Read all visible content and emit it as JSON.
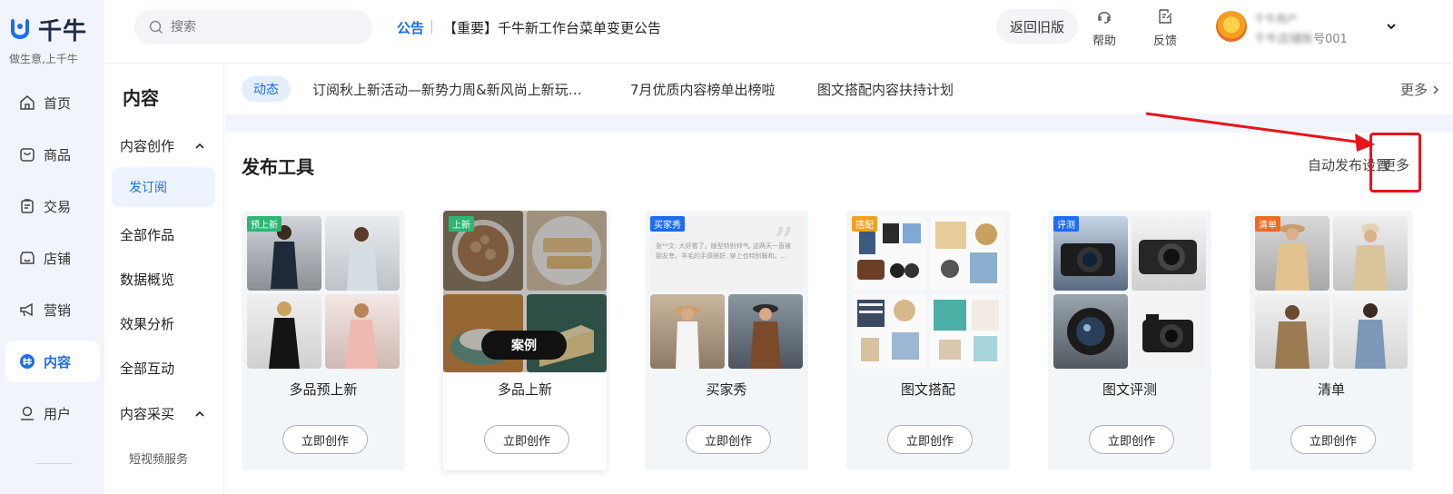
{
  "brand": {
    "name": "千牛",
    "slogan": "做生意,上千牛"
  },
  "rail": [
    {
      "label": "首页",
      "icon": "home-icon"
    },
    {
      "label": "商品",
      "icon": "bag-icon"
    },
    {
      "label": "交易",
      "icon": "clipboard-icon"
    },
    {
      "label": "店铺",
      "icon": "store-icon"
    },
    {
      "label": "营销",
      "icon": "megaphone-icon"
    },
    {
      "label": "内容",
      "icon": "content-icon",
      "active": true
    },
    {
      "label": "用户",
      "icon": "user-icon"
    }
  ],
  "header": {
    "search_placeholder": "搜索",
    "notice_label": "公告",
    "notice_text": "【重要】千牛新工作台菜单变更公告",
    "old_version": "返回旧版",
    "help": "帮助",
    "feedback": "反馈",
    "user": {
      "name": "千牛用户",
      "shop_prefix": "千牛店铺账",
      "shop_suffix": "号001"
    }
  },
  "subnav": {
    "title": "内容",
    "group_create": "内容创作",
    "publish": "发订阅",
    "all_works": "全部作品",
    "data_overview": "数据概览",
    "effect": "效果分析",
    "interaction": "全部互动",
    "group_purchase": "内容采买",
    "short_video": "短视频服务"
  },
  "news": {
    "tag": "动态",
    "items": [
      "订阅秋上新活动—新势力周&新风尚上新玩…",
      "7月优质内容榜单出榜啦",
      "图文搭配内容扶持计划"
    ],
    "more": "更多"
  },
  "tools": {
    "title": "发布工具",
    "auto_setting": "自动发布设置",
    "more": "更多",
    "create_label": "立即创作",
    "case_label": "案例",
    "cards": [
      {
        "name": "多品预上新",
        "tag": "预上新",
        "tag_color": "#2bb673"
      },
      {
        "name": "多品上新",
        "tag": "上新",
        "tag_color": "#2bb673"
      },
      {
        "name": "买家秀",
        "tag": "买家秀",
        "tag_color": "#1d6cf2",
        "quote": "张**文: 大好看了。版型特别帅气, 这两天一直被朋友夸。羊毛的手感很好, 穿上也特别暖和。..."
      },
      {
        "name": "图文搭配",
        "tag": "搭配",
        "tag_color": "#f5a020"
      },
      {
        "name": "图文评测",
        "tag": "评测",
        "tag_color": "#1d6cf2"
      },
      {
        "name": "清单",
        "tag": "清单",
        "tag_color": "#f06a1f"
      }
    ]
  },
  "colors": {
    "accent": "#1d6cf2",
    "highlight": "#e8141b",
    "rail_bg": "#f1f4fa"
  }
}
